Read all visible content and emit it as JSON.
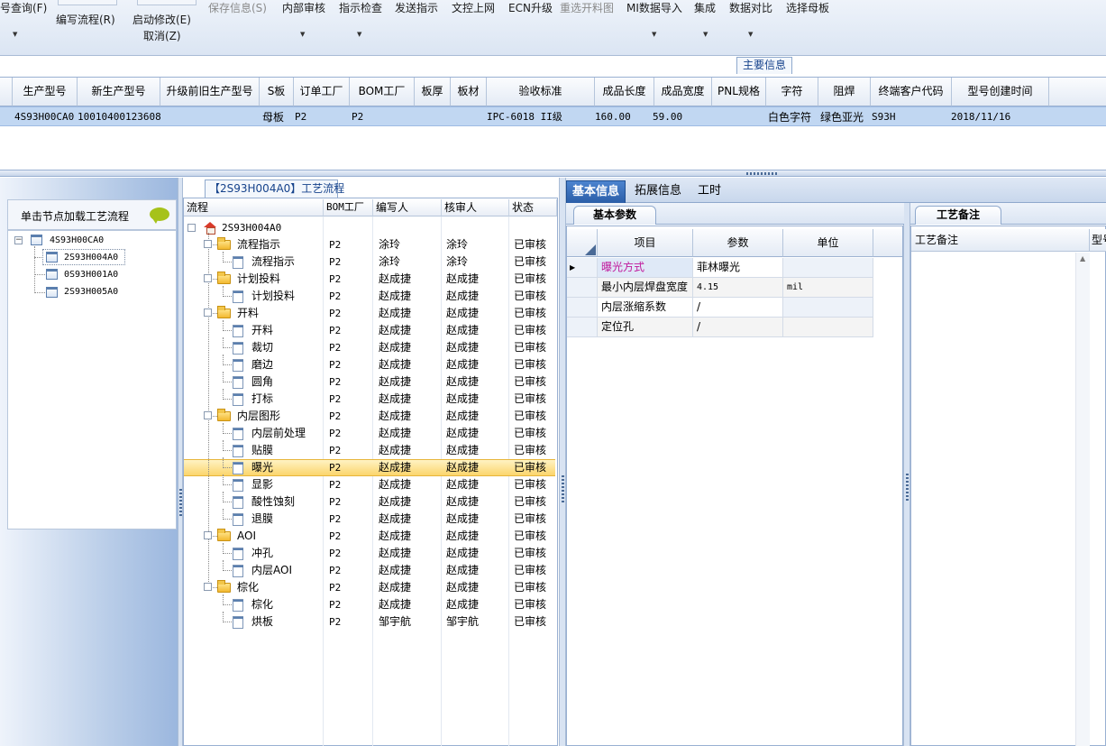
{
  "toolbar": {
    "items": [
      {
        "label": "号查询(F)",
        "disabled": false
      },
      {
        "label": "编写流程(R)",
        "disabled": false
      },
      {
        "label": "启动修改(E)",
        "disabled": false
      },
      {
        "label": "取消(Z)",
        "disabled": false
      },
      {
        "label": "保存信息(S)",
        "disabled": true
      },
      {
        "label": "内部审核",
        "disabled": false
      },
      {
        "label": "指示检查",
        "disabled": false
      },
      {
        "label": "发送指示",
        "disabled": false
      },
      {
        "label": "文控上网",
        "disabled": false
      },
      {
        "label": "ECN升级",
        "disabled": false
      },
      {
        "label": "重选开料图",
        "disabled": true
      },
      {
        "label": "MI数据导入",
        "disabled": false
      },
      {
        "label": "集成",
        "disabled": false
      },
      {
        "label": "数据对比",
        "disabled": false
      },
      {
        "label": "选择母板",
        "disabled": false
      }
    ]
  },
  "main_info": {
    "title": "主要信息",
    "columns": [
      "生产型号",
      "新生产型号",
      "升级前旧生产型号",
      "S板",
      "订单工厂",
      "BOM工厂",
      "板厚",
      "板材",
      "验收标准",
      "成品长度",
      "成品宽度",
      "PNL规格",
      "字符",
      "阻焊",
      "终端客户代码",
      "型号创建时间"
    ],
    "row": {
      "prod_model": "4S93H00CA0",
      "new_prod_model": "10010400123608",
      "old_model": "",
      "s_board": "母板",
      "order_factory": "P2",
      "bom_factory": "P2",
      "thickness": "",
      "material": "",
      "standard": "IPC-6018 II级",
      "length": "160.00",
      "width": "59.00",
      "pnl": "",
      "char": "白色字符",
      "solder": "绿色亚光",
      "customer": "S93H",
      "created": "2018/11/16"
    }
  },
  "left_panel": {
    "header": "单击节点加载工艺流程",
    "root": "4S93H00CA0",
    "children": [
      "2S93H004A0",
      "0S93H001A0",
      "2S93H005A0"
    ]
  },
  "process": {
    "title": "【2S93H004A0】工艺流程",
    "columns": [
      "流程",
      "BOM工厂",
      "编写人",
      "核审人",
      "状态"
    ],
    "root": "2S93H004A0",
    "rows": [
      {
        "name": "流程指示",
        "bom": "P2",
        "writer": "涂玲",
        "reviewer": "涂玲",
        "status": "已审核"
      },
      {
        "name": "流程指示",
        "bom": "P2",
        "writer": "涂玲",
        "reviewer": "涂玲",
        "status": "已审核"
      },
      {
        "name": "计划投料",
        "bom": "P2",
        "writer": "赵成捷",
        "reviewer": "赵成捷",
        "status": "已审核"
      },
      {
        "name": "计划投料",
        "bom": "P2",
        "writer": "赵成捷",
        "reviewer": "赵成捷",
        "status": "已审核"
      },
      {
        "name": "开料",
        "bom": "P2",
        "writer": "赵成捷",
        "reviewer": "赵成捷",
        "status": "已审核"
      },
      {
        "name": "开料",
        "bom": "P2",
        "writer": "赵成捷",
        "reviewer": "赵成捷",
        "status": "已审核"
      },
      {
        "name": "裁切",
        "bom": "P2",
        "writer": "赵成捷",
        "reviewer": "赵成捷",
        "status": "已审核"
      },
      {
        "name": "磨边",
        "bom": "P2",
        "writer": "赵成捷",
        "reviewer": "赵成捷",
        "status": "已审核"
      },
      {
        "name": "圆角",
        "bom": "P2",
        "writer": "赵成捷",
        "reviewer": "赵成捷",
        "status": "已审核"
      },
      {
        "name": "打标",
        "bom": "P2",
        "writer": "赵成捷",
        "reviewer": "赵成捷",
        "status": "已审核"
      },
      {
        "name": "内层图形",
        "bom": "P2",
        "writer": "赵成捷",
        "reviewer": "赵成捷",
        "status": "已审核"
      },
      {
        "name": "内层前处理",
        "bom": "P2",
        "writer": "赵成捷",
        "reviewer": "赵成捷",
        "status": "已审核"
      },
      {
        "name": "贴膜",
        "bom": "P2",
        "writer": "赵成捷",
        "reviewer": "赵成捷",
        "status": "已审核"
      },
      {
        "name": "曝光",
        "bom": "P2",
        "writer": "赵成捷",
        "reviewer": "赵成捷",
        "status": "已审核"
      },
      {
        "name": "显影",
        "bom": "P2",
        "writer": "赵成捷",
        "reviewer": "赵成捷",
        "status": "已审核"
      },
      {
        "name": "酸性蚀刻",
        "bom": "P2",
        "writer": "赵成捷",
        "reviewer": "赵成捷",
        "status": "已审核"
      },
      {
        "name": "退膜",
        "bom": "P2",
        "writer": "赵成捷",
        "reviewer": "赵成捷",
        "status": "已审核"
      },
      {
        "name": "AOI",
        "bom": "P2",
        "writer": "赵成捷",
        "reviewer": "赵成捷",
        "status": "已审核"
      },
      {
        "name": "冲孔",
        "bom": "P2",
        "writer": "赵成捷",
        "reviewer": "赵成捷",
        "status": "已审核"
      },
      {
        "name": "内层AOI",
        "bom": "P2",
        "writer": "赵成捷",
        "reviewer": "赵成捷",
        "status": "已审核"
      },
      {
        "name": "棕化",
        "bom": "P2",
        "writer": "赵成捷",
        "reviewer": "赵成捷",
        "status": "已审核"
      },
      {
        "name": "棕化",
        "bom": "P2",
        "writer": "赵成捷",
        "reviewer": "赵成捷",
        "status": "已审核"
      },
      {
        "name": "烘板",
        "bom": "P2",
        "writer": "邹宇航",
        "reviewer": "邹宇航",
        "status": "已审核"
      }
    ]
  },
  "right_tabs": [
    "基本信息",
    "拓展信息",
    "工时"
  ],
  "basic": {
    "tab": "基本参数",
    "columns": [
      "项目",
      "参数",
      "单位"
    ],
    "rows": [
      {
        "item": "曝光方式",
        "param": "菲林曝光",
        "unit": ""
      },
      {
        "item": "最小内层焊盘宽度",
        "param": "4.15",
        "unit": "mil"
      },
      {
        "item": "内层涨缩系数",
        "param": "/",
        "unit": ""
      },
      {
        "item": "定位孔",
        "param": "/",
        "unit": ""
      }
    ]
  },
  "remark": {
    "tab": "工艺备注",
    "column": "工艺备注",
    "column2": "型号"
  }
}
